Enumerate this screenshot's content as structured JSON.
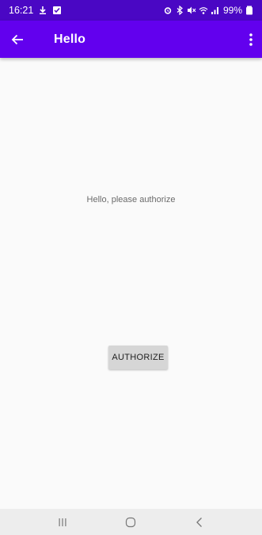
{
  "status_bar": {
    "time": "16:21",
    "battery": "99%",
    "icons_left": [
      "download-icon",
      "notification-check-icon"
    ],
    "icons_right": [
      "alarm-icon",
      "bluetooth-icon",
      "mute-icon",
      "wifi-icon",
      "signal-icon",
      "battery-icon"
    ]
  },
  "app_bar": {
    "title": "Hello",
    "color": "#6200ee",
    "status_color": "#4a07c4"
  },
  "main": {
    "message": "Hello, please authorize",
    "authorize_label": "AUTHORIZE"
  },
  "nav_bar": {
    "buttons": [
      "recent-apps-icon",
      "home-icon",
      "back-nav-icon"
    ]
  }
}
